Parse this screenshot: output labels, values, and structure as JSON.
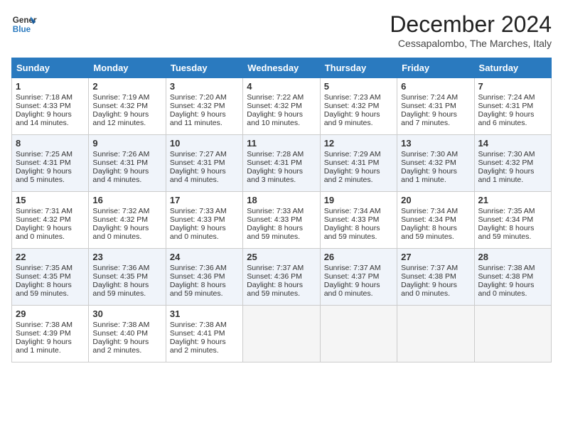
{
  "header": {
    "logo_line1": "General",
    "logo_line2": "Blue",
    "title": "December 2024",
    "location": "Cessapalombo, The Marches, Italy"
  },
  "weekdays": [
    "Sunday",
    "Monday",
    "Tuesday",
    "Wednesday",
    "Thursday",
    "Friday",
    "Saturday"
  ],
  "weeks": [
    [
      {
        "day": "1",
        "lines": [
          "Sunrise: 7:18 AM",
          "Sunset: 4:33 PM",
          "Daylight: 9 hours",
          "and 14 minutes."
        ]
      },
      {
        "day": "2",
        "lines": [
          "Sunrise: 7:19 AM",
          "Sunset: 4:32 PM",
          "Daylight: 9 hours",
          "and 12 minutes."
        ]
      },
      {
        "day": "3",
        "lines": [
          "Sunrise: 7:20 AM",
          "Sunset: 4:32 PM",
          "Daylight: 9 hours",
          "and 11 minutes."
        ]
      },
      {
        "day": "4",
        "lines": [
          "Sunrise: 7:22 AM",
          "Sunset: 4:32 PM",
          "Daylight: 9 hours",
          "and 10 minutes."
        ]
      },
      {
        "day": "5",
        "lines": [
          "Sunrise: 7:23 AM",
          "Sunset: 4:32 PM",
          "Daylight: 9 hours",
          "and 9 minutes."
        ]
      },
      {
        "day": "6",
        "lines": [
          "Sunrise: 7:24 AM",
          "Sunset: 4:31 PM",
          "Daylight: 9 hours",
          "and 7 minutes."
        ]
      },
      {
        "day": "7",
        "lines": [
          "Sunrise: 7:24 AM",
          "Sunset: 4:31 PM",
          "Daylight: 9 hours",
          "and 6 minutes."
        ]
      }
    ],
    [
      {
        "day": "8",
        "lines": [
          "Sunrise: 7:25 AM",
          "Sunset: 4:31 PM",
          "Daylight: 9 hours",
          "and 5 minutes."
        ]
      },
      {
        "day": "9",
        "lines": [
          "Sunrise: 7:26 AM",
          "Sunset: 4:31 PM",
          "Daylight: 9 hours",
          "and 4 minutes."
        ]
      },
      {
        "day": "10",
        "lines": [
          "Sunrise: 7:27 AM",
          "Sunset: 4:31 PM",
          "Daylight: 9 hours",
          "and 4 minutes."
        ]
      },
      {
        "day": "11",
        "lines": [
          "Sunrise: 7:28 AM",
          "Sunset: 4:31 PM",
          "Daylight: 9 hours",
          "and 3 minutes."
        ]
      },
      {
        "day": "12",
        "lines": [
          "Sunrise: 7:29 AM",
          "Sunset: 4:31 PM",
          "Daylight: 9 hours",
          "and 2 minutes."
        ]
      },
      {
        "day": "13",
        "lines": [
          "Sunrise: 7:30 AM",
          "Sunset: 4:32 PM",
          "Daylight: 9 hours",
          "and 1 minute."
        ]
      },
      {
        "day": "14",
        "lines": [
          "Sunrise: 7:30 AM",
          "Sunset: 4:32 PM",
          "Daylight: 9 hours",
          "and 1 minute."
        ]
      }
    ],
    [
      {
        "day": "15",
        "lines": [
          "Sunrise: 7:31 AM",
          "Sunset: 4:32 PM",
          "Daylight: 9 hours",
          "and 0 minutes."
        ]
      },
      {
        "day": "16",
        "lines": [
          "Sunrise: 7:32 AM",
          "Sunset: 4:32 PM",
          "Daylight: 9 hours",
          "and 0 minutes."
        ]
      },
      {
        "day": "17",
        "lines": [
          "Sunrise: 7:33 AM",
          "Sunset: 4:33 PM",
          "Daylight: 9 hours",
          "and 0 minutes."
        ]
      },
      {
        "day": "18",
        "lines": [
          "Sunrise: 7:33 AM",
          "Sunset: 4:33 PM",
          "Daylight: 8 hours",
          "and 59 minutes."
        ]
      },
      {
        "day": "19",
        "lines": [
          "Sunrise: 7:34 AM",
          "Sunset: 4:33 PM",
          "Daylight: 8 hours",
          "and 59 minutes."
        ]
      },
      {
        "day": "20",
        "lines": [
          "Sunrise: 7:34 AM",
          "Sunset: 4:34 PM",
          "Daylight: 8 hours",
          "and 59 minutes."
        ]
      },
      {
        "day": "21",
        "lines": [
          "Sunrise: 7:35 AM",
          "Sunset: 4:34 PM",
          "Daylight: 8 hours",
          "and 59 minutes."
        ]
      }
    ],
    [
      {
        "day": "22",
        "lines": [
          "Sunrise: 7:35 AM",
          "Sunset: 4:35 PM",
          "Daylight: 8 hours",
          "and 59 minutes."
        ]
      },
      {
        "day": "23",
        "lines": [
          "Sunrise: 7:36 AM",
          "Sunset: 4:35 PM",
          "Daylight: 8 hours",
          "and 59 minutes."
        ]
      },
      {
        "day": "24",
        "lines": [
          "Sunrise: 7:36 AM",
          "Sunset: 4:36 PM",
          "Daylight: 8 hours",
          "and 59 minutes."
        ]
      },
      {
        "day": "25",
        "lines": [
          "Sunrise: 7:37 AM",
          "Sunset: 4:36 PM",
          "Daylight: 8 hours",
          "and 59 minutes."
        ]
      },
      {
        "day": "26",
        "lines": [
          "Sunrise: 7:37 AM",
          "Sunset: 4:37 PM",
          "Daylight: 9 hours",
          "and 0 minutes."
        ]
      },
      {
        "day": "27",
        "lines": [
          "Sunrise: 7:37 AM",
          "Sunset: 4:38 PM",
          "Daylight: 9 hours",
          "and 0 minutes."
        ]
      },
      {
        "day": "28",
        "lines": [
          "Sunrise: 7:38 AM",
          "Sunset: 4:38 PM",
          "Daylight: 9 hours",
          "and 0 minutes."
        ]
      }
    ],
    [
      {
        "day": "29",
        "lines": [
          "Sunrise: 7:38 AM",
          "Sunset: 4:39 PM",
          "Daylight: 9 hours",
          "and 1 minute."
        ]
      },
      {
        "day": "30",
        "lines": [
          "Sunrise: 7:38 AM",
          "Sunset: 4:40 PM",
          "Daylight: 9 hours",
          "and 2 minutes."
        ]
      },
      {
        "day": "31",
        "lines": [
          "Sunrise: 7:38 AM",
          "Sunset: 4:41 PM",
          "Daylight: 9 hours",
          "and 2 minutes."
        ]
      },
      null,
      null,
      null,
      null
    ]
  ]
}
